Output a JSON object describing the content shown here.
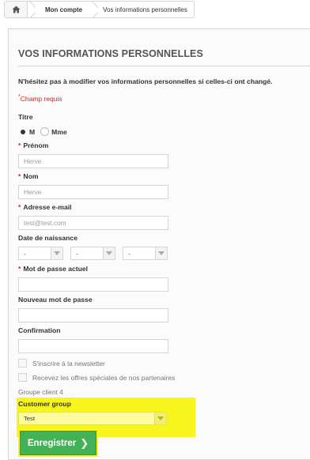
{
  "breadcrumb": {
    "home_icon": "home-icon",
    "account": "Mon compte",
    "current": "Vos informations personnelles"
  },
  "page": {
    "title": "VOS INFORMATIONS PERSONNELLES",
    "intro": "N'hésitez pas à modifier vos informations personnelles si celles-ci ont changé.",
    "required_mark": "*",
    "required_note": "Champ requis"
  },
  "form": {
    "title_label": "Titre",
    "title_options": [
      {
        "label": "M",
        "checked": true
      },
      {
        "label": "Mme",
        "checked": false
      }
    ],
    "firstname_label": "Prénom",
    "firstname_value": "Herve",
    "lastname_label": "Nom",
    "lastname_value": "Herve",
    "email_label": "Adresse e-mail",
    "email_value": "test@test.com",
    "birthdate_label": "Date de naissance",
    "birthdate_day": "-",
    "birthdate_month": "-",
    "birthdate_year": "-",
    "current_password_label": "Mot de passe actuel",
    "new_password_label": "Nouveau mot de passe",
    "confirmation_label": "Confirmation",
    "newsletter_label": "S'inscrire à la newsletter",
    "partners_label": "Recevez les offres spéciales de nos partenaires",
    "group_client_label": "Groupe client 4",
    "customer_group_label": "Customer group",
    "customer_group_value": "Test",
    "submit_label": "Enregistrer",
    "submit_chevron": "❯"
  },
  "colors": {
    "accent_green": "#43b155",
    "required_red": "#d81f1f",
    "highlight_yellow": "#f7f51c"
  }
}
